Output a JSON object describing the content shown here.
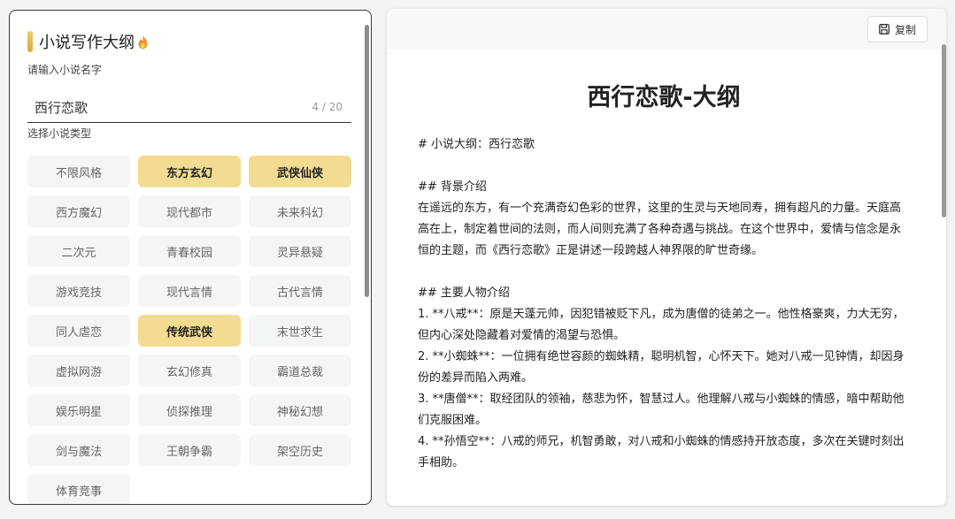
{
  "left": {
    "title": "小说写作大纲",
    "name_label": "请输入小说名字",
    "name_value": "西行恋歌",
    "name_count": "4 / 20",
    "type_label": "选择小说类型",
    "types": [
      {
        "label": "不限风格",
        "selected": false
      },
      {
        "label": "东方玄幻",
        "selected": true
      },
      {
        "label": "武侠仙侠",
        "selected": true
      },
      {
        "label": "西方魔幻",
        "selected": false
      },
      {
        "label": "现代都市",
        "selected": false
      },
      {
        "label": "未来科幻",
        "selected": false
      },
      {
        "label": "二次元",
        "selected": false
      },
      {
        "label": "青春校园",
        "selected": false
      },
      {
        "label": "灵异悬疑",
        "selected": false
      },
      {
        "label": "游戏竞技",
        "selected": false
      },
      {
        "label": "现代言情",
        "selected": false
      },
      {
        "label": "古代言情",
        "selected": false
      },
      {
        "label": "同人虐恋",
        "selected": false
      },
      {
        "label": "传统武侠",
        "selected": true
      },
      {
        "label": "末世求生",
        "selected": false
      },
      {
        "label": "虚拟网游",
        "selected": false
      },
      {
        "label": "玄幻修真",
        "selected": false
      },
      {
        "label": "霸道总裁",
        "selected": false
      },
      {
        "label": "娱乐明星",
        "selected": false
      },
      {
        "label": "侦探推理",
        "selected": false
      },
      {
        "label": "神秘幻想",
        "selected": false
      },
      {
        "label": "剑与魔法",
        "selected": false
      },
      {
        "label": "王朝争霸",
        "selected": false
      },
      {
        "label": "架空历史",
        "selected": false
      },
      {
        "label": "体育竞事",
        "selected": false
      }
    ],
    "accent_color": "#f2dc92"
  },
  "right": {
    "copy_label": "复制",
    "doc_title": "西行恋歌-大纲",
    "lines": [
      "# 小说大纲：西行恋歌",
      "",
      "## 背景介绍",
      "在遥远的东方，有一个充满奇幻色彩的世界，这里的生灵与天地同寿，拥有超凡的力量。天庭高高在上，制定着世间的法则，而人间则充满了各种奇遇与挑战。在这个世界中，爱情与信念是永恒的主题，而《西行恋歌》正是讲述一段跨越人神界限的旷世奇缘。",
      "",
      "## 主要人物介绍",
      "1. **八戒**：原是天蓬元帅，因犯错被贬下凡，成为唐僧的徒弟之一。他性格豪爽，力大无穷，但内心深处隐藏着对爱情的渴望与恐惧。",
      "2. **小蜘蛛**：一位拥有绝世容颜的蜘蛛精，聪明机智，心怀天下。她对八戒一见钟情，却因身份的差异而陷入两难。",
      "3. **唐僧**：取经团队的领袖，慈悲为怀，智慧过人。他理解八戒与小蜘蛛的情感，暗中帮助他们克服困难。",
      "4. **孙悟空**：八戒的师兄，机智勇敢，对八戒和小蜘蛛的情感持开放态度，多次在关键时刻出手相助。"
    ]
  }
}
